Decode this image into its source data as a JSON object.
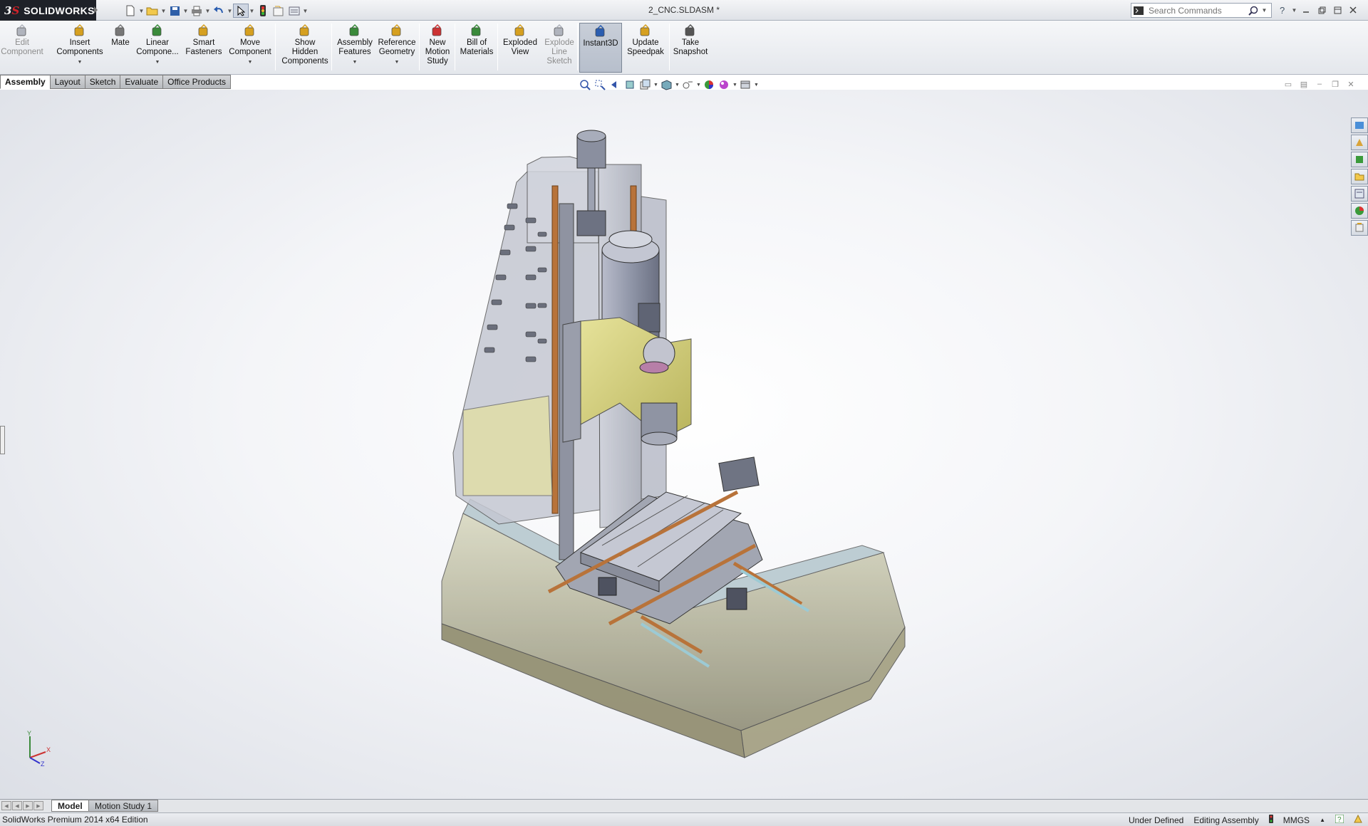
{
  "app": {
    "logo_text": "SOLIDWORKS",
    "document_title": "2_CNC.SLDASM *"
  },
  "search": {
    "placeholder": "Search Commands"
  },
  "ribbon": {
    "buttons": [
      {
        "label": "Edit Component",
        "icon": "edit-component-icon",
        "disabled": true
      },
      {
        "label": "Insert Components",
        "icon": "insert-components-icon"
      },
      {
        "label": "Mate",
        "icon": "mate-icon"
      },
      {
        "label": "Linear Compone...",
        "icon": "linear-pattern-icon"
      },
      {
        "label": "Smart Fasteners",
        "icon": "smart-fasteners-icon"
      },
      {
        "label": "Move Component",
        "icon": "move-component-icon"
      },
      {
        "label": "Show Hidden Components",
        "icon": "show-hidden-icon"
      },
      {
        "label": "Assembly Features",
        "icon": "assembly-features-icon"
      },
      {
        "label": "Reference Geometry",
        "icon": "reference-geometry-icon"
      },
      {
        "label": "New Motion Study",
        "icon": "motion-study-icon"
      },
      {
        "label": "Bill of Materials",
        "icon": "bom-icon"
      },
      {
        "label": "Exploded View",
        "icon": "exploded-view-icon"
      },
      {
        "label": "Explode Line Sketch",
        "icon": "explode-line-icon",
        "disabled": true
      },
      {
        "label": "Instant3D",
        "icon": "instant3d-icon",
        "active": true
      },
      {
        "label": "Update Speedpak",
        "icon": "speedpak-icon"
      },
      {
        "label": "Take Snapshot",
        "icon": "snapshot-icon"
      }
    ]
  },
  "tabs": [
    "Assembly",
    "Layout",
    "Sketch",
    "Evaluate",
    "Office Products"
  ],
  "bottom_tabs": [
    "Model",
    "Motion Study 1"
  ],
  "status": {
    "edition": "SolidWorks Premium 2014 x64 Edition",
    "state": "Under Defined",
    "mode": "Editing Assembly",
    "units": "MMGS"
  },
  "colors": {
    "accent_red": "#d2232a",
    "carriage_yellow": "#d6d27a",
    "rail_copper": "#b8733a",
    "body_gray": "#9aa0ad"
  }
}
